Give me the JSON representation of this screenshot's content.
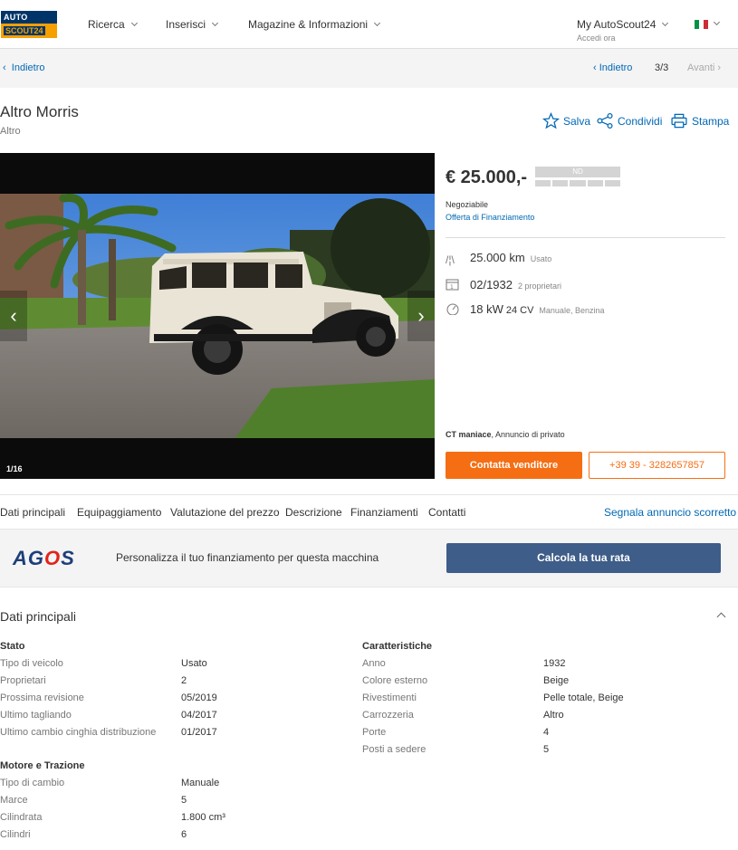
{
  "header": {
    "logo_top": "AUTO",
    "logo_bottom": "SCOUT24",
    "nav": [
      "Ricerca",
      "Inserisci",
      "Magazine & Informazioni"
    ],
    "account_title": "My AutoScout24",
    "account_sub": "Accedi ora",
    "flag_colors": [
      "#009246",
      "#ffffff",
      "#ce2b37"
    ]
  },
  "backbar": {
    "back": "Indietro",
    "back_right": "Indietro",
    "pager": "3/3",
    "next": "Avanti"
  },
  "listing": {
    "title": "Altro Morris",
    "subtitle": "Altro",
    "actions": {
      "save": "Salva",
      "share": "Condividi",
      "print": "Stampa"
    },
    "gallery_counter": "1/16",
    "price": "€ 25.000,-",
    "price_rating": "ND",
    "negotiable": "Negoziabile",
    "financing_link": "Offerta di Finanziamento",
    "mileage": "25.000 km",
    "mileage_note": "Usato",
    "registration": "02/1932",
    "registration_note": "2 proprietari",
    "power": "18 kW",
    "power_cv": "24 CV",
    "power_note": "Manuale, Benzina",
    "seller_name": "CT maniace",
    "seller_type": ", Annuncio di privato",
    "contact_button": "Contatta venditore",
    "phone_button": "+39 39 - 3282657857"
  },
  "tabs": [
    "Dati principali",
    "Equipaggiamento",
    "Valutazione del prezzo",
    "Descrizione",
    "Finanziamenti",
    "Contatti"
  ],
  "report_link": "Segnala annuncio scorretto",
  "agos": {
    "logo_a": "AG",
    "logo_o": "O",
    "logo_s": "S",
    "text": "Personalizza il tuo finanziamento per questa macchina",
    "button": "Calcola la tua rata"
  },
  "details": {
    "title": "Dati principali",
    "stato": {
      "heading": "Stato",
      "rows": [
        [
          "Tipo di veicolo",
          "Usato"
        ],
        [
          "Proprietari",
          "2"
        ],
        [
          "Prossima revisione",
          "05/2019"
        ],
        [
          "Ultimo tagliando",
          "04/2017"
        ],
        [
          "Ultimo cambio cinghia distribuzione",
          "01/2017"
        ]
      ]
    },
    "caratteristiche": {
      "heading": "Caratteristiche",
      "rows": [
        [
          "Anno",
          "1932"
        ],
        [
          "Colore esterno",
          "Beige"
        ],
        [
          "Rivestimenti",
          "Pelle totale, Beige"
        ],
        [
          "Carrozzeria",
          "Altro"
        ],
        [
          "Porte",
          "4"
        ],
        [
          "Posti a sedere",
          "5"
        ]
      ]
    },
    "motore": {
      "heading": "Motore e Trazione",
      "rows": [
        [
          "Tipo di cambio",
          "Manuale"
        ],
        [
          "Marce",
          "5"
        ],
        [
          "Cilindrata",
          "1.800 cm³"
        ],
        [
          "Cilindri",
          "6"
        ]
      ]
    }
  }
}
